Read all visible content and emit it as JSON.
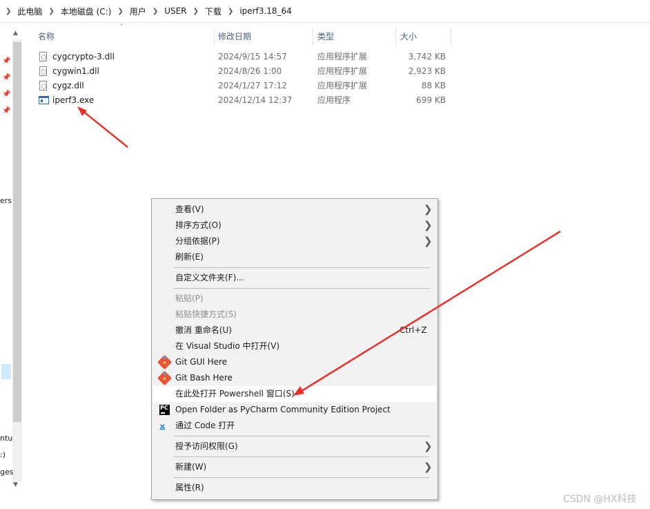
{
  "breadcrumb": [
    "此电脑",
    "本地磁盘 (C:)",
    "用户",
    "USER",
    "下载",
    "iperf3.18_64"
  ],
  "columns": {
    "name": "名称",
    "modified": "修改日期",
    "type": "类型",
    "size": "大小"
  },
  "files": [
    {
      "name": "cygcrypto-3.dll",
      "modified": "2024/9/15 14:57",
      "type": "应用程序扩展",
      "size": "3,742 KB",
      "icon": "dll-file-icon"
    },
    {
      "name": "cygwin1.dll",
      "modified": "2024/8/26 1:00",
      "type": "应用程序扩展",
      "size": "2,923 KB",
      "icon": "dll-file-icon"
    },
    {
      "name": "cygz.dll",
      "modified": "2024/1/27 17:12",
      "type": "应用程序扩展",
      "size": "88 KB",
      "icon": "dll-file-icon"
    },
    {
      "name": "iperf3.exe",
      "modified": "2024/12/14 12:37",
      "type": "应用程序",
      "size": "699 KB",
      "icon": "exe-file-icon"
    }
  ],
  "left_pane_fragments": [
    "ers",
    "ntu",
    ":)",
    "ges"
  ],
  "context_menu": {
    "view": "查看(V)",
    "sort": "排序方式(O)",
    "group": "分组依据(P)",
    "refresh": "刷新(E)",
    "customize": "自定义文件夹(F)...",
    "paste": "粘贴(P)",
    "paste_shortcut": "粘贴快捷方式(S)",
    "undo_rename": "撤消 重命名(U)",
    "undo_shortcut": "Ctrl+Z",
    "open_vs": "在 Visual Studio 中打开(V)",
    "git_gui": "Git GUI Here",
    "git_bash": "Git Bash Here",
    "powershell": "在此处打开 Powershell 窗口(S)",
    "pycharm": "Open Folder as PyCharm Community Edition Project",
    "vscode": "通过 Code 打开",
    "grant_access": "授予访问权限(G)",
    "new": "新建(W)",
    "properties": "属性(R)",
    "highlighted_item": "powershell"
  },
  "colors": {
    "annotation_arrow": "#e8312a",
    "menu_bg": "#f2f2f2",
    "header_text": "#4c607a"
  },
  "watermark": "CSDN @HX科技"
}
